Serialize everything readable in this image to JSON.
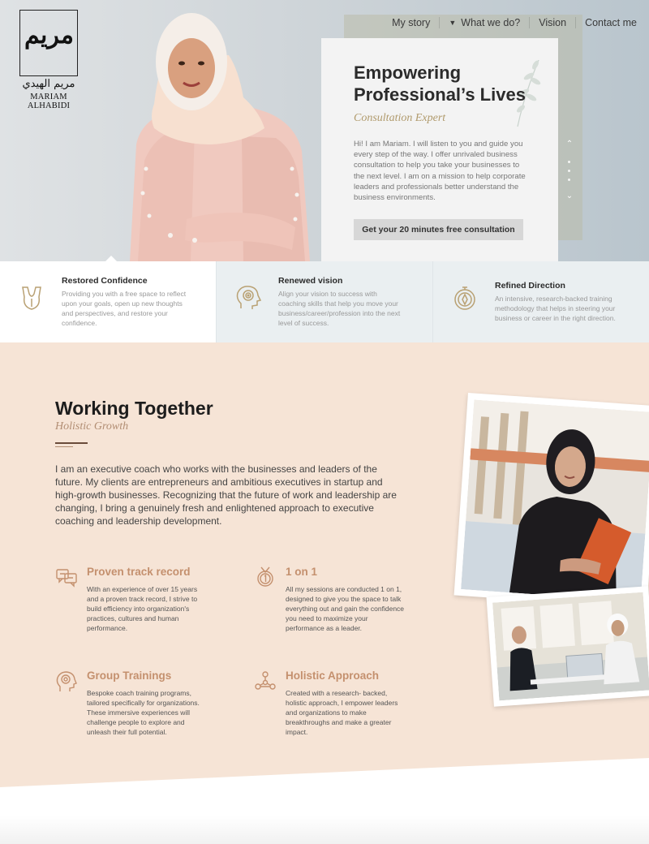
{
  "brand": {
    "logo_glyph": "مريم",
    "logo_arabic": "مريم الهيدي",
    "logo_name": "MARIAM ALHABIDI"
  },
  "nav": {
    "items": [
      {
        "label": "My story"
      },
      {
        "label": "What we do?",
        "has_dropdown": true
      },
      {
        "label": "Vision"
      },
      {
        "label": "Contact me"
      }
    ]
  },
  "hero": {
    "title": "Empowering Professional’s Lives",
    "subtitle": "Consultation Expert",
    "text": "Hi! I am Mariam. I will listen to you and guide you every step of the way. I offer unrivaled business consultation to help you take your businesses to the next level. I am on a mission to help corporate leaders and professionals better understand the business environments.",
    "cta_label": "Get your 20 minutes free consultation",
    "slider_up": "⌃",
    "slider_down": "⌄"
  },
  "features": [
    {
      "title": "Restored Confidence",
      "text": "Providing you with a free space to reflect upon your goals, open up new thoughts and perspectives, and restore your confidence.",
      "icon": "confidence-icon"
    },
    {
      "title": "Renewed vision",
      "text": "Align your vision to success with coaching skills that help you move your business/career/profession into the next level of success.",
      "icon": "vision-head-icon"
    },
    {
      "title": "Refined Direction",
      "text": "An intensive, research-backed training methodology that helps in steering your business or career in the right direction.",
      "icon": "compass-icon"
    }
  ],
  "work": {
    "title": "Working Together",
    "subtitle": "Holistic Growth",
    "intro": "I am an executive coach who works with the businesses and leaders of the future. My clients are entrepreneurs and ambitious executives in startup and high-growth businesses. Recognizing that the future of work and leadership are changing, I bring a genuinely fresh and enlightened approach to executive coaching and leadership development.",
    "services": [
      {
        "title": "Proven track record",
        "text": "With an experience of over 15 years and a proven track record, I strive to build efficiency into organization's practices, cultures and human performance.",
        "icon": "chat-icon"
      },
      {
        "title": "1 on 1",
        "text": "All my sessions are conducted 1 on 1, designed to give you the space to talk everything out and gain the confidence you need to maximize your performance as a leader.",
        "icon": "medal-icon"
      },
      {
        "title": "Group Trainings",
        "text": "Bespoke coach training programs, tailored specifically for organizations. These immersive experiences will challenge people to explore and unleash their full potential.",
        "icon": "brain-head-icon"
      },
      {
        "title": "Holistic Approach",
        "text": "Created with a research- backed, holistic approach, I empower leaders and organizations to make breakthroughs and make a greater impact.",
        "icon": "network-icon"
      }
    ]
  },
  "colors": {
    "accent": "#c4906e",
    "gold": "#b09a6c",
    "peach_bg": "#f6e4d6",
    "hero_bg": "#cfd5d9"
  }
}
